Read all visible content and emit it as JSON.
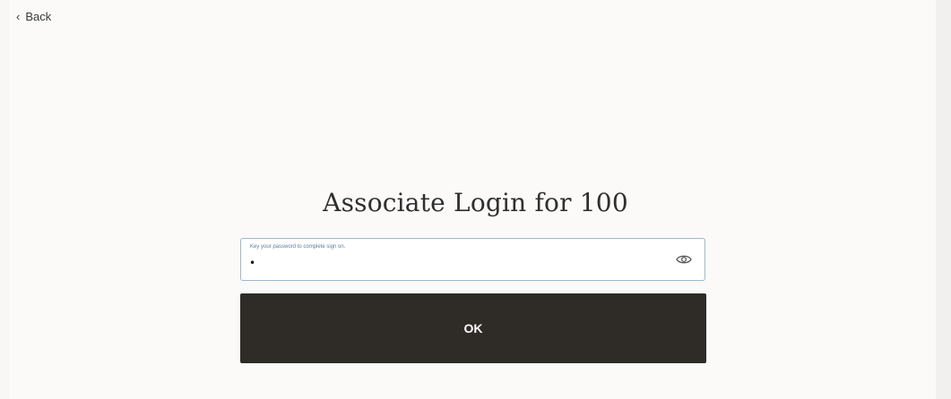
{
  "header": {
    "back_label": "Back",
    "back_icon": "chevron-left-icon"
  },
  "main": {
    "title": "Associate Login for 100",
    "password": {
      "label": "Key your password to complete sign on.",
      "value": "•",
      "toggle_icon": "eye-icon"
    },
    "ok_label": "OK"
  },
  "colors": {
    "button_bg": "#2f2b27",
    "field_border": "#9db9cc",
    "field_label": "#5b7ea1"
  }
}
